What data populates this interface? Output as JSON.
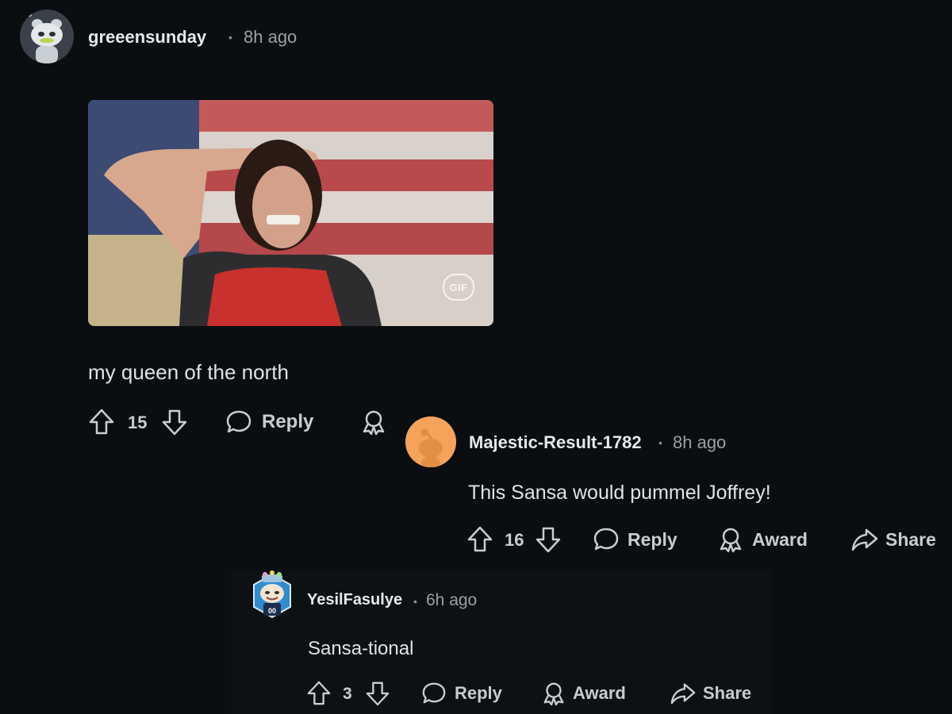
{
  "comments": [
    {
      "username": "greeensunday",
      "time": "8h ago",
      "separator": "•",
      "gif_badge": "GIF",
      "body": "my queen of the north",
      "score": "15",
      "actions": {
        "reply": "Reply"
      }
    },
    {
      "username": "Majestic-Result-1782",
      "time": "8h ago",
      "separator": "•",
      "body": "This Sansa would pummel Joffrey!",
      "score": "16",
      "actions": {
        "reply": "Reply",
        "award": "Award",
        "share": "Share"
      }
    },
    {
      "username": "YesilFasulye",
      "time": "6h ago",
      "separator": "•",
      "body": "Sansa-tional",
      "score": "3",
      "actions": {
        "reply": "Reply",
        "award": "Award",
        "share": "Share"
      }
    }
  ],
  "colors": {
    "background": "#0b0e11",
    "text": "#d7dadc",
    "muted": "#9aa0a6",
    "snoo_orange": "#f5a25a"
  },
  "icons": [
    "upvote-icon",
    "downvote-icon",
    "reply-bubble-icon",
    "award-icon",
    "share-icon",
    "gif-badge"
  ]
}
